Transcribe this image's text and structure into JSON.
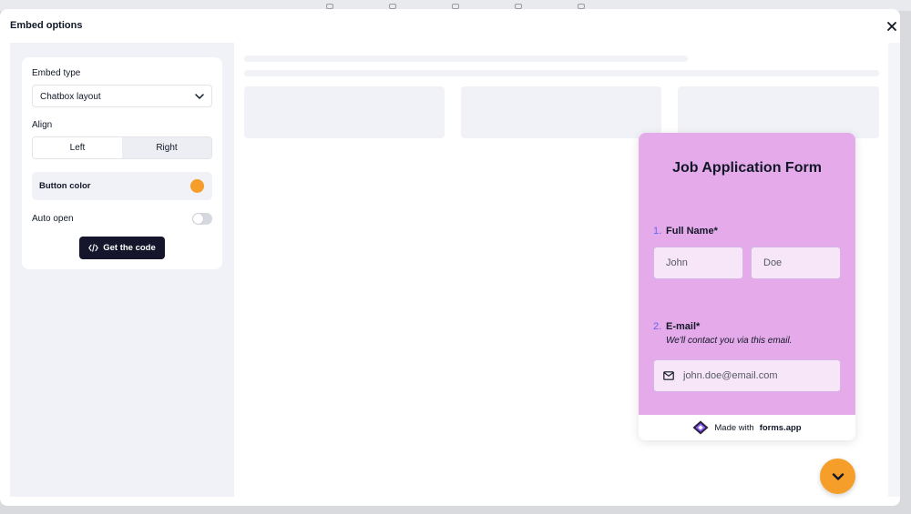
{
  "modal": {
    "title": "Embed options"
  },
  "settings": {
    "embed_type_label": "Embed type",
    "embed_type_value": "Chatbox layout",
    "align_label": "Align",
    "align_options": [
      "Left",
      "Right"
    ],
    "align_selected": "Right",
    "button_color_label": "Button color",
    "button_color": "#f59e2a",
    "auto_open_label": "Auto open",
    "auto_open": false,
    "get_code_label": "Get the code"
  },
  "form": {
    "title": "Job Application Form",
    "background": "#e5aaea",
    "questions": [
      {
        "number": "1.",
        "label": "Full Name",
        "required_mark": "*",
        "fields": [
          "John",
          "Doe"
        ]
      },
      {
        "number": "2.",
        "label": "E-mail",
        "required_mark": "*",
        "description": "We'll contact you via this email.",
        "placeholder": "john.doe@email.com"
      }
    ],
    "footer_prefix": "Made with",
    "footer_brand": "forms.app"
  },
  "colors": {
    "accent": "#f59e2a",
    "number": "#6366f1",
    "dark_button": "#15162b"
  },
  "icons": {
    "close": "close-icon",
    "chevron": "chevron-down-icon",
    "code": "code-icon",
    "mail": "mail-icon",
    "logo": "forms-app-logo-icon",
    "fab": "chevron-down-icon"
  }
}
